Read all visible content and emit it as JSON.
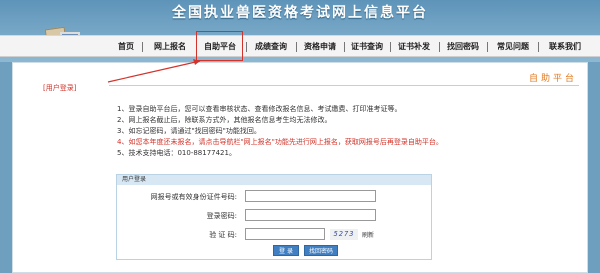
{
  "header": {
    "title": "全国执业兽医资格考试网上信息平台"
  },
  "nav": {
    "items": [
      "首页",
      "网上报名",
      "自助平台",
      "成绩查询",
      "资格申请",
      "证书查询",
      "证书补发",
      "找回密码",
      "常见问题",
      "联系我们"
    ],
    "active": "自助平台"
  },
  "section": {
    "title": "自助平台"
  },
  "annotation": {
    "label": "[用户登录]"
  },
  "notes": [
    {
      "text": "1、登录自助平台后，您可以查看审核状态、查看修改报名信息、考试缴费、打印准考证等。",
      "color": "#333333"
    },
    {
      "text": "2、网上报名截止后，除联系方式外，其他报名信息考生均无法修改。",
      "color": "#333333"
    },
    {
      "text": "3、如忘记密码，请通过\"找回密码\"功能找回。",
      "color": "#333333"
    },
    {
      "text": "4、如您本年度还未报名，请点击导航栏\"网上报名\"功能先进行网上报名，获取网报号后再登录自助平台。",
      "color": "#d2332a"
    },
    {
      "text": "5、技术支持电话：010-88177421。",
      "color": "#333333"
    }
  ],
  "login": {
    "panel_title": "用户登录",
    "id_label": "网报号或有效身份证件号码:",
    "password_label": "登录密码:",
    "captcha_label": "验 证 码:",
    "captcha_text": "5273",
    "refresh_label": "刷新",
    "login_button": "登 录",
    "forgot_button": "找回密码"
  }
}
